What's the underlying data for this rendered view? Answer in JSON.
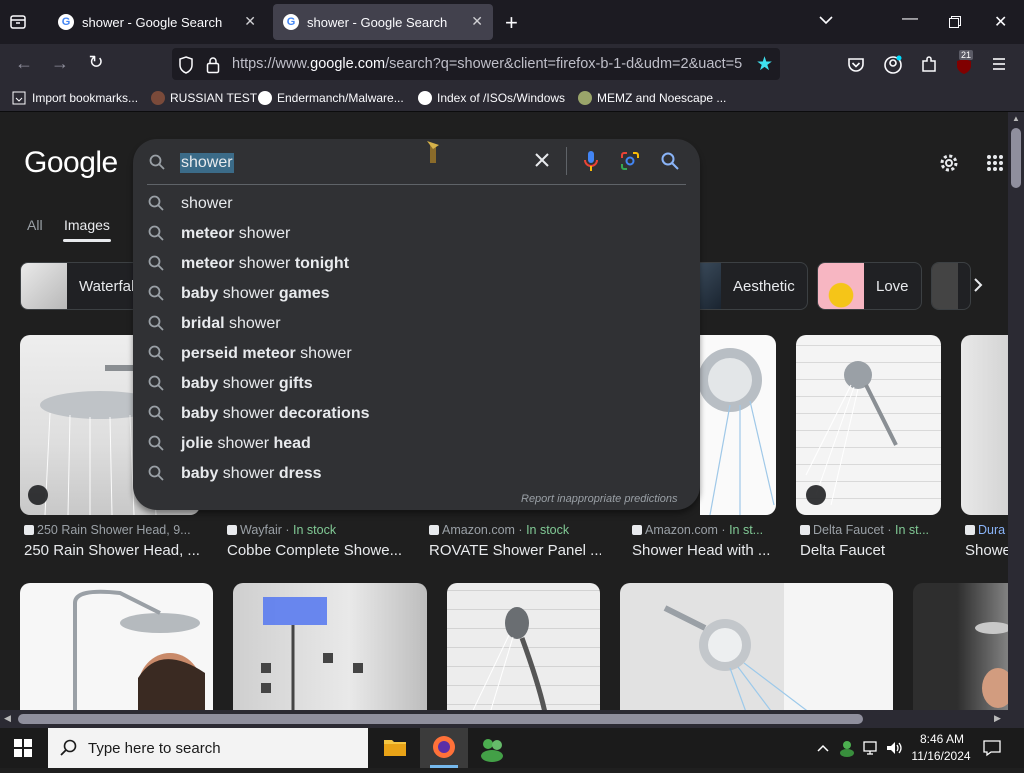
{
  "browser": {
    "tabs": [
      {
        "title": "shower - Google Search",
        "active": false
      },
      {
        "title": "shower - Google Search",
        "active": true
      }
    ],
    "url_prefix": "https://www.",
    "url_domain": "google.com",
    "url_rest": "/search?q=shower&client=firefox-b-1-d&udm=2&uact=5",
    "extension_badge": "21",
    "bookmarks": [
      "Import bookmarks...",
      "RUSSIAN TEST",
      "Endermanch/Malware...",
      "Index of /ISOs/Windows",
      "MEMZ and Noescape ..."
    ]
  },
  "google": {
    "logo": "Google",
    "query": "shower",
    "nav_tabs": [
      "All",
      "Images"
    ],
    "suggestions": [
      {
        "pre": "",
        "bold": "",
        "post": "shower"
      },
      {
        "pre": "",
        "bold": "meteor",
        "post": " shower"
      },
      {
        "pre": "",
        "bold": "meteor",
        "post": " shower ",
        "bold2": "tonight"
      },
      {
        "pre": "",
        "bold": "baby",
        "post": " shower ",
        "bold2": "games"
      },
      {
        "pre": "",
        "bold": "bridal",
        "post": " shower"
      },
      {
        "pre": "",
        "bold": "perseid meteor",
        "post": " shower"
      },
      {
        "pre": "",
        "bold": "baby",
        "post": " shower ",
        "bold2": "gifts"
      },
      {
        "pre": "",
        "bold": "baby",
        "post": " shower ",
        "bold2": "decorations"
      },
      {
        "pre": "",
        "bold": "jolie",
        "post": " shower ",
        "bold2": "head"
      },
      {
        "pre": "",
        "bold": "baby",
        "post": " shower ",
        "bold2": "dress"
      }
    ],
    "report_text": "Report inappropriate predictions",
    "chips": [
      "Waterfall",
      "Aesthetic",
      "Love"
    ],
    "results": [
      {
        "source": "250 Rain Shower Head, 9...",
        "instock": "",
        "caption": "250 Rain Shower Head, ..."
      },
      {
        "source": "Wayfair",
        "instock": "In stock",
        "caption": "Cobbe Complete Showe..."
      },
      {
        "source": "Amazon.com",
        "instock": "In stock",
        "caption": "ROVATE Shower Panel ..."
      },
      {
        "source": "Amazon.com",
        "instock": "In st...",
        "caption": "Shower Head with ..."
      },
      {
        "source": "Delta Faucet",
        "instock": "In st...",
        "caption": "Delta Faucet"
      },
      {
        "source": "Dura",
        "instock": "",
        "caption": "Showe"
      }
    ]
  },
  "taskbar": {
    "search_placeholder": "Type here to search",
    "time": "8:46 AM",
    "date": "11/16/2024"
  },
  "colors": {
    "accent_blue": "#8ab4f8",
    "instock_green": "#81c995",
    "selection": "#3b6b88"
  }
}
